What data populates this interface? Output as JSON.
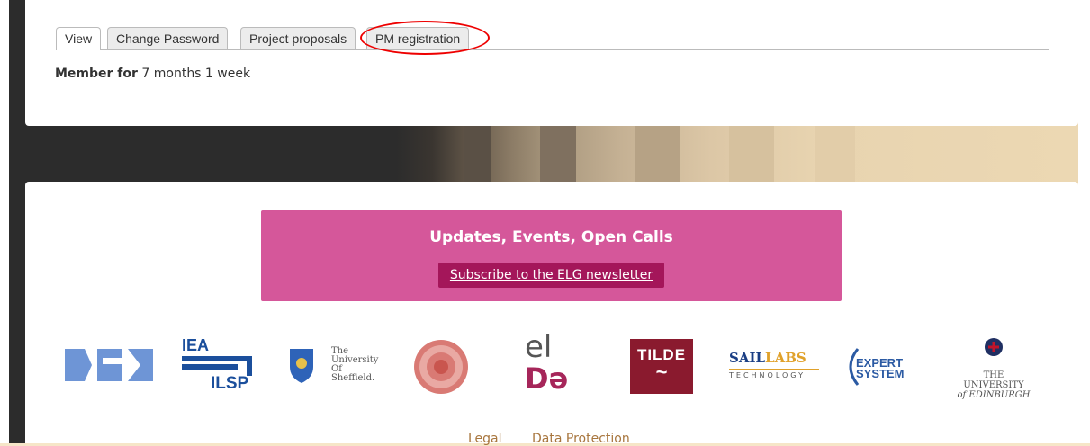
{
  "tabs": [
    {
      "label": "View",
      "active": true
    },
    {
      "label": "Change Password",
      "active": false
    },
    {
      "label": "Project proposals",
      "active": false
    },
    {
      "label": "PM registration",
      "active": false
    }
  ],
  "member": {
    "label": "Member for",
    "value": "7 months 1 week"
  },
  "newsletter": {
    "title": "Updates, Events, Open Calls",
    "link": "Subscribe to the ELG newsletter",
    "color": "#d5579a"
  },
  "logos": {
    "dfki": {
      "name": "dfki-logo"
    },
    "ilsp": {
      "text_top": "IEA",
      "text_bottom": "ILSP"
    },
    "sheffield": {
      "line1": "The",
      "line2": "University",
      "line3": "Of",
      "line4": "Sheffield."
    },
    "charles": {
      "name": "charles-university-seal"
    },
    "elda": {
      "top": "el",
      "bottom": "Dә"
    },
    "tilde": {
      "text": "TILDE"
    },
    "saillabs": {
      "main1": "SAIL",
      "main2": "LABS",
      "sub": "TECHNOLOGY"
    },
    "expert": {
      "line1": "EXPERT",
      "line2": "SYSTEM"
    },
    "edinburgh": {
      "line1": "THE UNIVERSITY",
      "line2": "of EDINBURGH"
    }
  },
  "footer": {
    "legal": "Legal",
    "data_protection": "Data Protection"
  }
}
